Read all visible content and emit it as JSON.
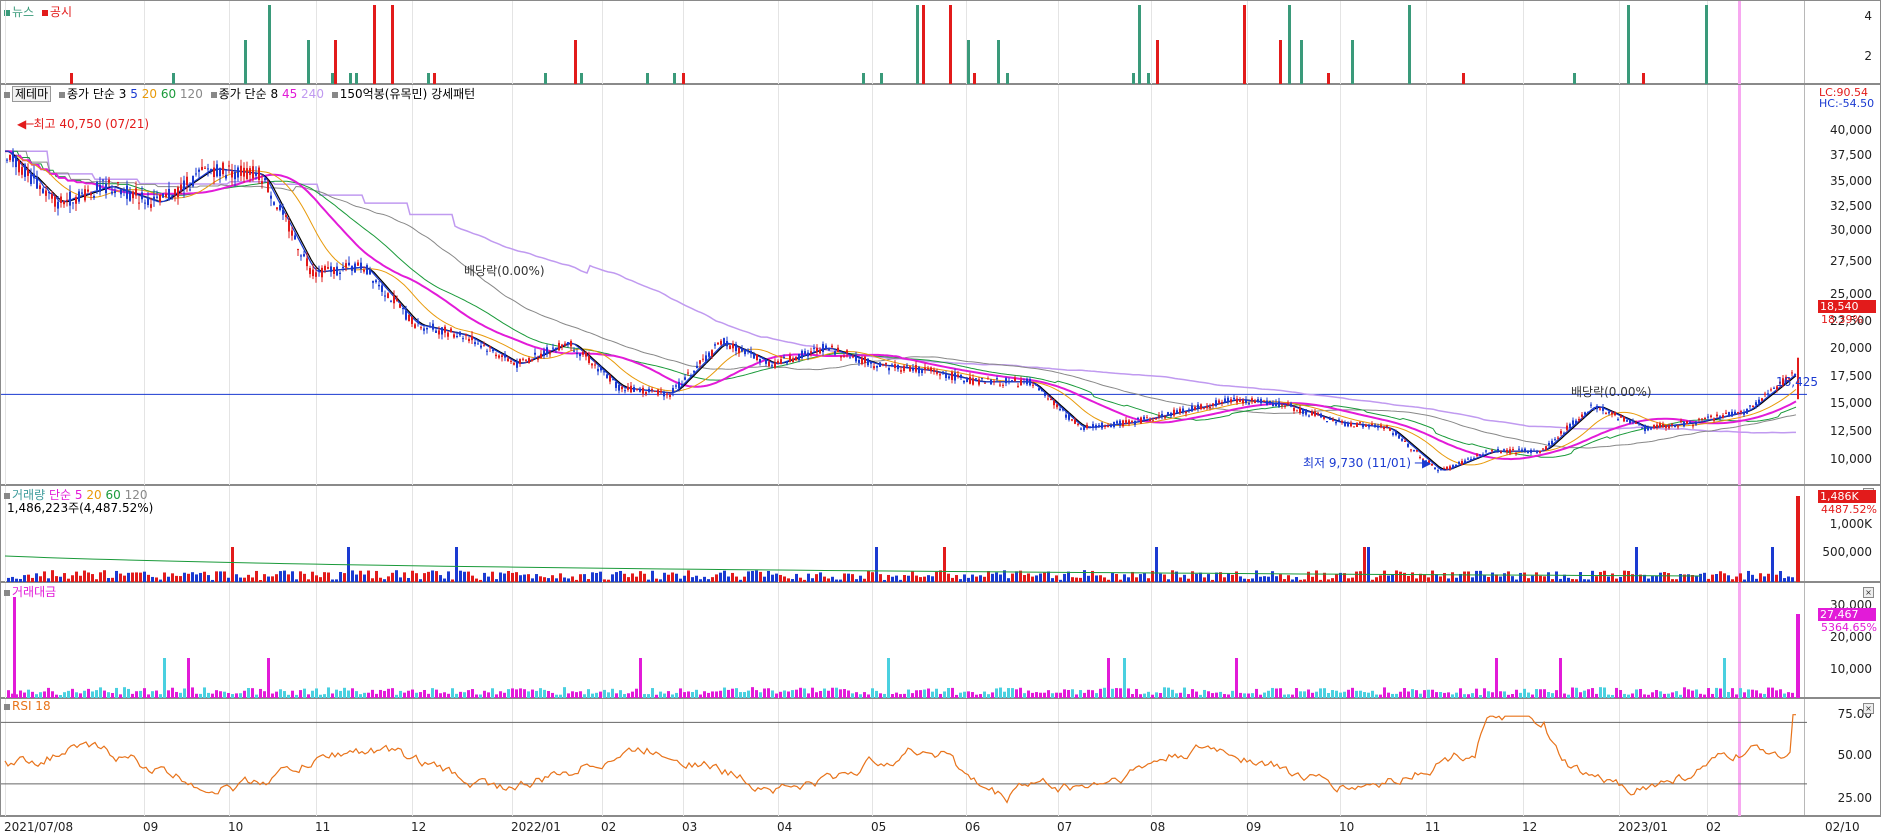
{
  "news_pane": {
    "legend": [
      "뉴스",
      "공시"
    ],
    "ticks": [
      "4",
      "2"
    ],
    "news_color": "#3a9a7a",
    "disclosure_color": "#e21b1b"
  },
  "price_pane": {
    "legend": {
      "theme": "제테마",
      "close_ma": "종가 단순",
      "p1": "3",
      "p2": "5",
      "p3": "20",
      "p4": "60",
      "p5": "120",
      "close_ma2": "종가 단순",
      "q1": "8",
      "q2": "45",
      "q3": "240",
      "extra": "150억봉(유목민) 강세패턴"
    },
    "high_marker": "최고 40,750 (07/21)",
    "low_marker": "최저 9,730 (11/01)",
    "dividend_label_1": "배당락(0.00%)",
    "dividend_label_2": "배당락(0.00%)",
    "hline_value": "16,425",
    "lc": "LC:90.54",
    "hc": "HC:-54.50",
    "current_price": "18,540",
    "current_pct": "18.39%",
    "ticks": [
      "40,000",
      "37,500",
      "35,000",
      "32,500",
      "30,000",
      "27,500",
      "25,000",
      "22,500",
      "20,000",
      "17,500",
      "15,000",
      "12,500",
      "10,000"
    ]
  },
  "volume_pane": {
    "title": "거래량",
    "ma": "단순",
    "p1": "5",
    "p2": "20",
    "p3": "60",
    "p4": "120",
    "readout": "1,486,223주(4,487.52%)",
    "current": "1,486K",
    "current_pct": "4487.52%",
    "ticks": [
      "1,000K",
      "500,000"
    ]
  },
  "amount_pane": {
    "title": "거래대금",
    "current": "27,467",
    "current_pct": "5364.65%",
    "ticks": [
      "30,000",
      "20,000",
      "10,000"
    ]
  },
  "rsi_pane": {
    "title": "RSI 18",
    "ticks": [
      "75.00",
      "50.00",
      "25.00"
    ]
  },
  "x_axis": [
    "2021/07/08",
    "09",
    "10",
    "11",
    "12",
    "2022/01",
    "02",
    "03",
    "04",
    "05",
    "06",
    "07",
    "08",
    "09",
    "10",
    "11",
    "12",
    "2023/01",
    "02",
    "02/10"
  ],
  "chart_data": {
    "type": "line",
    "title": "제테마",
    "series": [
      {
        "name": "종가",
        "values": [
          37500,
          33000,
          34500,
          33000,
          36000,
          35500,
          27000,
          27500,
          22500,
          21500,
          19000,
          21000,
          17000,
          16500,
          21000,
          19000,
          20500,
          19000,
          18500,
          17500,
          17500,
          13500,
          14000,
          15000,
          16000,
          15500,
          14000,
          13500,
          9730,
          11500,
          11500,
          15500,
          13500,
          14000,
          15000,
          18540
        ]
      }
    ],
    "ylim": [
      9000,
      41500
    ],
    "volume_last": 1486223,
    "rsi_last": 75
  }
}
